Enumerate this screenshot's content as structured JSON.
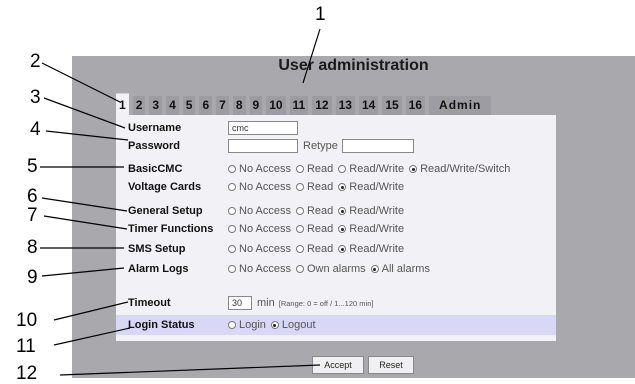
{
  "title": "User administration",
  "tabs": [
    "1",
    "2",
    "3",
    "4",
    "5",
    "6",
    "7",
    "8",
    "9",
    "10",
    "11",
    "12",
    "13",
    "14",
    "15",
    "16",
    "Admin"
  ],
  "active_tab": "1",
  "callouts": [
    "1",
    "2",
    "3",
    "4",
    "5",
    "6",
    "7",
    "8",
    "9",
    "10",
    "11",
    "12"
  ],
  "form": {
    "username_label": "Username",
    "username_value": "cmc",
    "password_label": "Password",
    "password_value": "",
    "retype_label": "Retype",
    "retype_value": "",
    "basiccmc_label": "BasicCMC",
    "voltage_label": "Voltage Cards",
    "general_label": "General Setup",
    "timer_label": "Timer Functions",
    "sms_label": "SMS Setup",
    "alarm_label": "Alarm Logs",
    "timeout_label": "Timeout",
    "timeout_value": "30",
    "timeout_unit": "min",
    "timeout_range": "[Range: 0 = off / 1...120 min]",
    "login_label": "Login Status"
  },
  "options": {
    "no_access": "No Access",
    "read": "Read",
    "read_write": "Read/Write",
    "read_write_switch": "Read/Write/Switch",
    "own_alarms": "Own alarms",
    "all_alarms": "All alarms",
    "login": "Login",
    "logout": "Logout"
  },
  "selected": {
    "basiccmc": "Read/Write/Switch",
    "voltage": "Read/Write",
    "general": "Read/Write",
    "timer": "Read/Write",
    "sms": "Read/Write",
    "alarm": "All alarms",
    "login_status": "Logout"
  },
  "buttons": {
    "accept": "Accept",
    "reset": "Reset"
  }
}
